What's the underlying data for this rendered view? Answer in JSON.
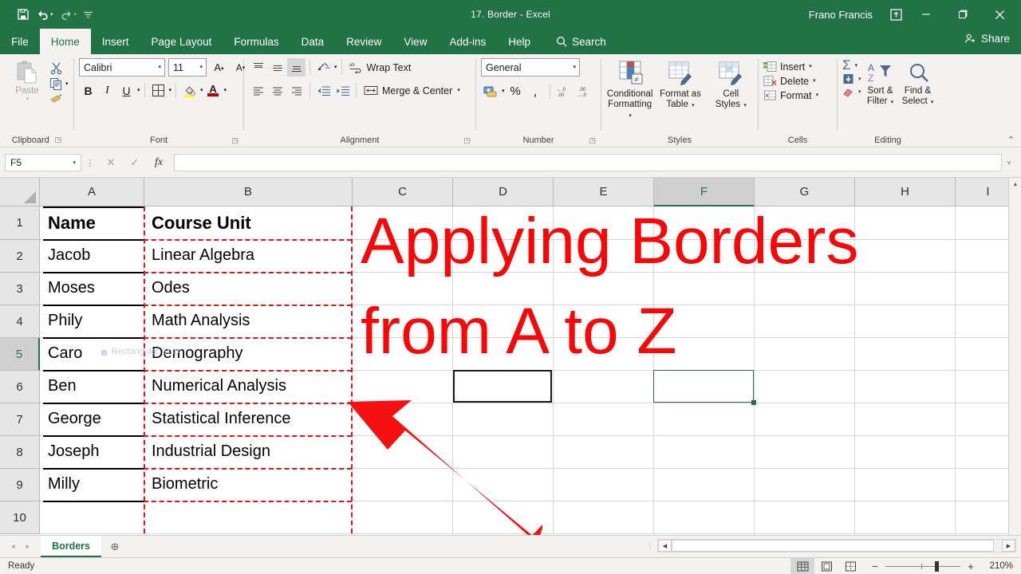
{
  "titlebar": {
    "document_title": "17. Border  -  Excel",
    "user_name": "Frano Francis",
    "quick_access": [
      {
        "name": "save-icon",
        "label": "Save"
      },
      {
        "name": "undo-icon",
        "label": "Undo"
      },
      {
        "name": "redo-icon",
        "label": "Redo"
      },
      {
        "name": "customize-qat-icon",
        "label": "Customize Quick Access Toolbar"
      }
    ],
    "window_controls": {
      "ribbon_display": "Ribbon Display Options",
      "minimize": "─",
      "restore": "❐",
      "close": "✕"
    }
  },
  "tabs": [
    {
      "label": "File",
      "active": false
    },
    {
      "label": "Home",
      "active": true
    },
    {
      "label": "Insert",
      "active": false
    },
    {
      "label": "Page Layout",
      "active": false
    },
    {
      "label": "Formulas",
      "active": false
    },
    {
      "label": "Data",
      "active": false
    },
    {
      "label": "Review",
      "active": false
    },
    {
      "label": "View",
      "active": false
    },
    {
      "label": "Add-ins",
      "active": false
    },
    {
      "label": "Help",
      "active": false
    }
  ],
  "search": {
    "label": "Search"
  },
  "share": {
    "label": "Share"
  },
  "ribbon": {
    "clipboard": {
      "group_label": "Clipboard",
      "paste_label": "Paste",
      "cut_label": "Cut",
      "copy_label": "Copy",
      "format_painter_label": "Format Painter"
    },
    "font": {
      "group_label": "Font",
      "font_name": "Calibri",
      "font_size": "11",
      "increase_size_label": "A",
      "decrease_size_label": "A",
      "bold_label": "B",
      "italic_label": "I",
      "underline_label": "U",
      "borders_label": "Borders",
      "fill_color_label": "Fill Color",
      "font_color_label": "A"
    },
    "alignment": {
      "group_label": "Alignment",
      "wrap_text_label": "Wrap Text",
      "merge_center_label": "Merge & Center",
      "orientation_label": "Orientation",
      "decrease_indent_label": "Decrease Indent",
      "increase_indent_label": "Increase Indent"
    },
    "number": {
      "group_label": "Number",
      "format_value": "General",
      "accounting_label": "Accounting Number Format",
      "percent_label": "%",
      "comma_label": ",",
      "increase_decimal_label": ".00",
      "decrease_decimal_label": ".00"
    },
    "styles": {
      "group_label": "Styles",
      "conditional_formatting_line1": "Conditional",
      "conditional_formatting_line2": "Formatting",
      "format_as_table_line1": "Format as",
      "format_as_table_line2": "Table",
      "cell_styles_line1": "Cell",
      "cell_styles_line2": "Styles"
    },
    "cells": {
      "group_label": "Cells",
      "insert_label": "Insert",
      "delete_label": "Delete",
      "format_label": "Format"
    },
    "editing": {
      "group_label": "Editing",
      "autosum_label": "Σ",
      "fill_label": "Fill",
      "clear_label": "Clear",
      "sort_filter_line1": "Sort &",
      "sort_filter_line2": "Filter",
      "find_select_line1": "Find &",
      "find_select_line2": "Select"
    },
    "collapse_label": "⌃"
  },
  "formula_bar": {
    "name_box_value": "F5",
    "cancel_label": "✕",
    "enter_label": "✓",
    "insert_function_label": "fx",
    "formula_value": "",
    "expand_label": "˅"
  },
  "grid": {
    "column_headers": [
      "A",
      "B",
      "C",
      "D",
      "E",
      "F",
      "G",
      "H",
      "I"
    ],
    "selected_column": "F",
    "row_headers": [
      "1",
      "2",
      "3",
      "4",
      "5",
      "6",
      "7",
      "8",
      "9",
      "10"
    ],
    "selected_row": "5",
    "active_cell": "F5",
    "watermark_text": "Rectangular Snip",
    "rows": [
      {
        "row": "1",
        "A": "Name",
        "B": "Course Unit",
        "bold": true
      },
      {
        "row": "2",
        "A": "Jacob",
        "B": "Linear Algebra",
        "bold": false
      },
      {
        "row": "3",
        "A": "Moses",
        "B": "Odes",
        "bold": false
      },
      {
        "row": "4",
        "A": "Phily",
        "B": "Math Analysis",
        "bold": false
      },
      {
        "row": "5",
        "A": "Caro",
        "B": "Demography",
        "bold": false
      },
      {
        "row": "6",
        "A": "Ben",
        "B": "Numerical Analysis",
        "bold": false
      },
      {
        "row": "7",
        "A": "George",
        "B": "Statistical Inference",
        "bold": false
      },
      {
        "row": "8",
        "A": "Joseph",
        "B": "Industrial Design",
        "bold": false
      },
      {
        "row": "9",
        "A": "Milly",
        "B": "Biometric",
        "bold": false
      },
      {
        "row": "10",
        "A": "",
        "B": "",
        "bold": false
      }
    ]
  },
  "overlay": {
    "line1": "Applying Borders",
    "line2": "from A to Z",
    "color": "#fb0606",
    "arrow_name": "red-arrow-annotation"
  },
  "sheet_bar": {
    "prev_label": "◂",
    "next_label": "▸",
    "tabs": [
      {
        "label": "Borders",
        "active": true
      }
    ],
    "add_sheet_label": "⊕"
  },
  "status_bar": {
    "status_text": "Ready",
    "views": [
      {
        "name": "normal-view",
        "active": true
      },
      {
        "name": "page-layout-view",
        "active": false
      },
      {
        "name": "page-break-view",
        "active": false
      }
    ],
    "zoom_out_label": "−",
    "zoom_in_label": "+",
    "zoom_value": "210%"
  },
  "colors": {
    "excel_green": "#217346",
    "ribbon_bg": "#f3f2f1",
    "border_red": "#d31b1b",
    "annotation_red": "#fb0606"
  }
}
